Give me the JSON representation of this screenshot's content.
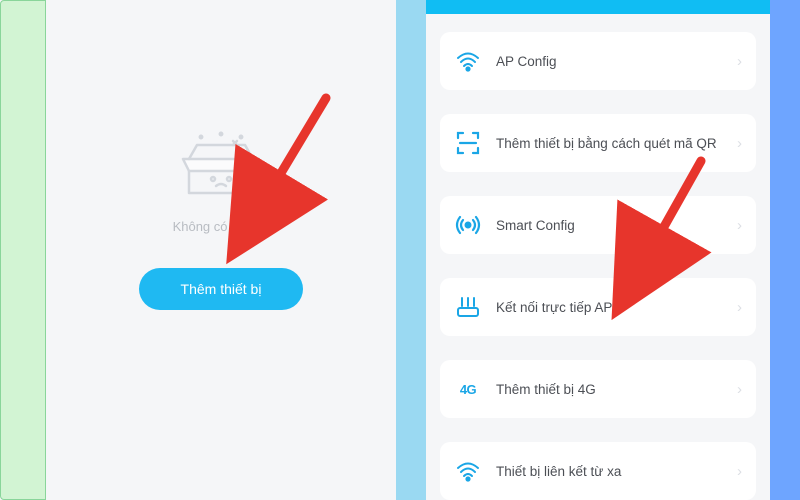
{
  "colors": {
    "primary": "#1fb9f2",
    "iconBlue": "#1aa6e6",
    "muted": "#b8bcc2",
    "arrow": "#e7352c"
  },
  "leftPanel": {
    "emptyLabel": "Không có thiết bị",
    "addButton": "Thêm thiết bị"
  },
  "options": [
    {
      "icon": "wifi-icon",
      "label": "AP Config"
    },
    {
      "icon": "qr-icon",
      "label": "Thêm thiết bị bằng cách quét mã QR"
    },
    {
      "icon": "signal-icon",
      "label": "Smart Config"
    },
    {
      "icon": "router-icon",
      "label": "Kết nối trực tiếp AP"
    },
    {
      "icon": "fourg-icon",
      "label": "Thêm thiết bị 4G",
      "text4g": "4G"
    },
    {
      "icon": "remote-icon",
      "label": "Thiết bị liên kết từ xa"
    }
  ]
}
